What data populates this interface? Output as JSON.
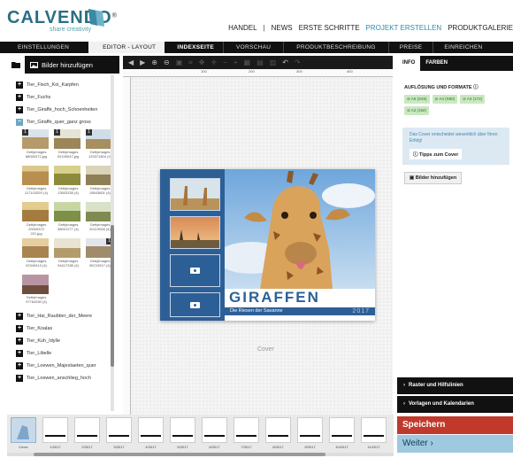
{
  "header": {
    "brand": "CALVENDO",
    "brand_mark": "®",
    "tagline": "share creativity",
    "nav": [
      "HANDEL",
      "|",
      "NEWS",
      "ERSTE SCHRITTE",
      "PROJEKT ERSTELLEN",
      "PRODUKTGALERIE"
    ],
    "active_nav": "PROJEKT ERSTELLEN"
  },
  "tabs": [
    "EINSTELLUNGEN",
    "EDITOR - LAYOUT",
    "INDEXSEITE",
    "VORSCHAU",
    "PRODUKTBESCHREIBUNG",
    "PREISE",
    "EINREICHEN"
  ],
  "left_panel": {
    "add_images": "Bilder hinzufügen",
    "folders_top": [
      "Tier_Fisch_Koi_Karpfen",
      "Tier_Fuchs",
      "Tier_Giraffe_hoch_Schoenheiten",
      "Tier_Giraffe_quer_ganz gross"
    ],
    "thumbs": [
      {
        "num": "1",
        "cap": "GettyImages 88050372.jpg"
      },
      {
        "num": "1",
        "cap": "GettyImages 92195047.jpg"
      },
      {
        "num": "1",
        "cap": "GettyImages 123371804 (4)"
      },
      {
        "num": "",
        "cap": "GettyImages 11710320S (4)"
      },
      {
        "num": "",
        "cap": "GettyImages 13503335 (4)"
      },
      {
        "num": "",
        "cap": "GettyImages 18543801 (4)"
      },
      {
        "num": "",
        "cap": "GettyImages 29309372 221.jpg"
      },
      {
        "num": "",
        "cap": "GettyImages 58001277 (4)"
      },
      {
        "num": "",
        "cap": "GettyImages 52119008 (4)"
      },
      {
        "num": "",
        "cap": "GettyImages 92349413 (4)"
      },
      {
        "num": "",
        "cap": "GettyImages 94417285 (4)"
      },
      {
        "num": "1",
        "cap": "GettyImages 96724917 (4)"
      },
      {
        "num": "",
        "cap": "GettyImages 97764330 (4)"
      }
    ],
    "folders_bottom": [
      "Tier_Hai_Raubtier_der_Meere",
      "Tier_Koalas",
      "Tier_Kuh_Idylle",
      "Tier_Libelle",
      "Tier_Loewen_Majestaeten_quer",
      "Tier_Loewen_anschlieg_hoch"
    ]
  },
  "ruler": [
    "100",
    "200",
    "300",
    "400"
  ],
  "cover": {
    "title": "GIRAFFEN",
    "subtitle": "Die Riesen der Savanne",
    "year": "2017",
    "label": "Cover"
  },
  "right_panel": {
    "tabs": [
      "INFO",
      "FARBEN"
    ],
    "res_heading": "AUFLÖSUNG UND FORMATE",
    "formats": [
      "A5 (S45)",
      "A4 (S80)",
      "A3 (172)",
      "A2 (192)"
    ],
    "tip_text": "Das Cover entscheidet wesentlich über Ihren Erfolg!",
    "tip_button": "Tipps zum Cover",
    "add_images": "Bilder hinzufügen",
    "acc1": "Raster und Hilfslinien",
    "acc2": "Vorlagen und Kalendarien"
  },
  "pages": [
    "Cover",
    "1/2017",
    "2/2017",
    "3/2017",
    "4/2017",
    "5/2017",
    "6/2017",
    "7/2017",
    "8/2017",
    "9/2017",
    "10/2017",
    "11/2017"
  ],
  "actions": {
    "save": "Speichern",
    "next": "Weiter"
  },
  "colors": {
    "brand": "#2a6f84",
    "cover_blue": "#2d5f97",
    "save": "#c0392b",
    "next": "#9ec9df"
  }
}
